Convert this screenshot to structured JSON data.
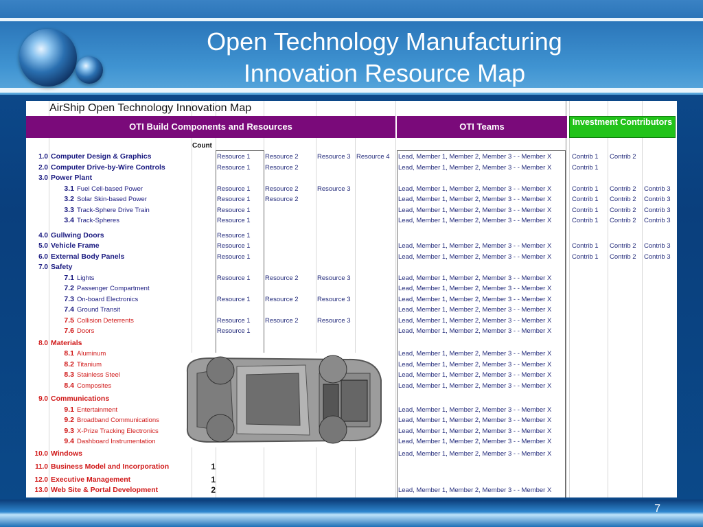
{
  "slide": {
    "title_line1": "Open Technology Manufacturing",
    "title_line2": "Innovation Resource Map",
    "page_number": "7"
  },
  "sheet": {
    "title": "AirShip Open Technology Innovation Map",
    "header_components": "OTI Build Components and Resources",
    "header_teams": "OTI Teams",
    "header_investment": "Investment Contributors",
    "header_count": "Count",
    "rows": [
      {
        "num": "1.0",
        "label": "Computer Design & Graphics",
        "level": 0,
        "red": false,
        "count": "",
        "res": [
          "Resource 1",
          "Resource 2",
          "Resource 3",
          "Resource 4"
        ],
        "team": "Lead, Member 1, Member 2, Member 3 - - Member X",
        "contrib": [
          "Contrib 1",
          "Contrib 2",
          ""
        ]
      },
      {
        "num": "2.0",
        "label": "Computer Drive-by-Wire Controls",
        "level": 0,
        "red": false,
        "count": "",
        "res": [
          "Resource 1",
          "Resource 2",
          "",
          ""
        ],
        "team": "Lead, Member 1, Member 2, Member 3 - - Member X",
        "contrib": [
          "Contrib 1",
          "",
          ""
        ]
      },
      {
        "num": "3.0",
        "label": "Power Plant",
        "level": 0,
        "red": false,
        "count": "",
        "res": [
          "",
          "",
          "",
          ""
        ],
        "team": "",
        "contrib": [
          "",
          "",
          ""
        ]
      },
      {
        "num": "3.1",
        "label": "Fuel Cell-based Power",
        "level": 1,
        "red": false,
        "count": "",
        "res": [
          "Resource 1",
          "Resource 2",
          "Resource 3",
          ""
        ],
        "team": "Lead, Member 1, Member 2, Member 3 - - Member X",
        "contrib": [
          "Contrib 1",
          "Contrib 2",
          "Contrib 3"
        ]
      },
      {
        "num": "3.2",
        "label": "Solar Skin-based Power",
        "level": 1,
        "red": false,
        "count": "",
        "res": [
          "Resource 1",
          "Resource 2",
          "",
          ""
        ],
        "team": "Lead, Member 1, Member 2, Member 3 - - Member X",
        "contrib": [
          "Contrib 1",
          "Contrib 2",
          "Contrib 3"
        ]
      },
      {
        "num": "3.3",
        "label": "Track-Sphere Drive Train",
        "level": 1,
        "red": false,
        "count": "",
        "res": [
          "Resource 1",
          "",
          "",
          ""
        ],
        "team": "Lead, Member 1, Member 2, Member 3 - - Member X",
        "contrib": [
          "Contrib 1",
          "Contrib 2",
          "Contrib 3"
        ]
      },
      {
        "num": "3.4",
        "label": "Track-Spheres",
        "level": 1,
        "red": false,
        "count": "",
        "res": [
          "Resource 1",
          "",
          "",
          ""
        ],
        "team": "Lead, Member 1, Member 2, Member 3 - - Member X",
        "contrib": [
          "Contrib 1",
          "Contrib 2",
          "Contrib 3"
        ]
      },
      {
        "num": "4.0",
        "label": "Gullwing Doors",
        "level": 0,
        "red": false,
        "count": "",
        "res": [
          "Resource 1",
          "",
          "",
          ""
        ],
        "team": "",
        "contrib": [
          "",
          "",
          ""
        ]
      },
      {
        "num": "5.0",
        "label": "Vehicle Frame",
        "level": 0,
        "red": false,
        "count": "",
        "res": [
          "Resource 1",
          "",
          "",
          ""
        ],
        "team": "Lead, Member 1, Member 2, Member 3 - - Member X",
        "contrib": [
          "Contrib 1",
          "Contrib 2",
          "Contrib 3"
        ]
      },
      {
        "num": "6.0",
        "label": "External Body Panels",
        "level": 0,
        "red": false,
        "count": "",
        "res": [
          "Resource 1",
          "",
          "",
          ""
        ],
        "team": "Lead, Member 1, Member 2, Member 3 - - Member X",
        "contrib": [
          "Contrib 1",
          "Contrib 2",
          "Contrib 3"
        ]
      },
      {
        "num": "7.0",
        "label": "Safety",
        "level": 0,
        "red": false,
        "count": "",
        "res": [
          "",
          "",
          "",
          ""
        ],
        "team": "",
        "contrib": [
          "",
          "",
          ""
        ]
      },
      {
        "num": "7.1",
        "label": "Lights",
        "level": 1,
        "red": false,
        "count": "",
        "res": [
          "Resource 1",
          "Resource 2",
          "Resource 3",
          ""
        ],
        "team": "Lead, Member 1, Member 2, Member 3 - - Member X",
        "contrib": [
          "",
          "",
          ""
        ]
      },
      {
        "num": "7.2",
        "label": "Passenger Compartment",
        "level": 1,
        "red": false,
        "count": "",
        "res": [
          "",
          "",
          "",
          ""
        ],
        "team": "Lead, Member 1, Member 2, Member 3 - - Member X",
        "contrib": [
          "",
          "",
          ""
        ]
      },
      {
        "num": "7.3",
        "label": "On-board Electronics",
        "level": 1,
        "red": false,
        "count": "",
        "res": [
          "Resource 1",
          "Resource 2",
          "Resource 3",
          ""
        ],
        "team": "Lead, Member 1, Member 2, Member 3 - - Member X",
        "contrib": [
          "",
          "",
          ""
        ]
      },
      {
        "num": "7.4",
        "label": "Ground Transit",
        "level": 1,
        "red": false,
        "count": "",
        "res": [
          "",
          "",
          "",
          ""
        ],
        "team": "Lead, Member 1, Member 2, Member 3 - - Member X",
        "contrib": [
          "",
          "",
          ""
        ]
      },
      {
        "num": "7.5",
        "label": "Collision Deterrents",
        "level": 1,
        "red": true,
        "count": "",
        "res": [
          "Resource 1",
          "Resource 2",
          "Resource 3",
          ""
        ],
        "team": "Lead, Member 1, Member 2, Member 3 - - Member X",
        "contrib": [
          "",
          "",
          ""
        ]
      },
      {
        "num": "7.6",
        "label": "Doors",
        "level": 1,
        "red": true,
        "count": "",
        "res": [
          "Resource 1",
          "",
          "",
          ""
        ],
        "team": "Lead, Member 1, Member 2, Member 3 - - Member X",
        "contrib": [
          "",
          "",
          ""
        ]
      },
      {
        "num": "8.0",
        "label": "Materials",
        "level": 0,
        "red": true,
        "count": "",
        "res": [
          "",
          "",
          "",
          ""
        ],
        "team": "",
        "contrib": [
          "",
          "",
          ""
        ]
      },
      {
        "num": "8.1",
        "label": "Aluminum",
        "level": 1,
        "red": true,
        "count": "",
        "res": [
          "",
          "",
          "",
          ""
        ],
        "team": "Lead, Member 1, Member 2, Member 3 - - Member X",
        "contrib": [
          "",
          "",
          ""
        ]
      },
      {
        "num": "8.2",
        "label": "Titanium",
        "level": 1,
        "red": true,
        "count": "",
        "res": [
          "",
          "",
          "",
          ""
        ],
        "team": "Lead, Member 1, Member 2, Member 3 - - Member X",
        "contrib": [
          "",
          "",
          ""
        ]
      },
      {
        "num": "8.3",
        "label": "Stainless Steel",
        "level": 1,
        "red": true,
        "count": "",
        "res": [
          "",
          "",
          "",
          ""
        ],
        "team": "Lead, Member 1, Member 2, Member 3 - - Member X",
        "contrib": [
          "",
          "",
          ""
        ]
      },
      {
        "num": "8.4",
        "label": "Composites",
        "level": 1,
        "red": true,
        "count": "",
        "res": [
          "",
          "",
          "",
          ""
        ],
        "team": "Lead, Member 1, Member 2, Member 3 - - Member X",
        "contrib": [
          "",
          "",
          ""
        ]
      },
      {
        "num": "9.0",
        "label": "Communications",
        "level": 0,
        "red": true,
        "count": "",
        "res": [
          "",
          "",
          "",
          ""
        ],
        "team": "",
        "contrib": [
          "",
          "",
          ""
        ]
      },
      {
        "num": "9.1",
        "label": "Entertainment",
        "level": 1,
        "red": true,
        "count": "",
        "res": [
          "",
          "",
          "",
          ""
        ],
        "team": "Lead, Member 1, Member 2, Member 3 - - Member X",
        "contrib": [
          "",
          "",
          ""
        ]
      },
      {
        "num": "9.2",
        "label": "Broadband Communications",
        "level": 1,
        "red": true,
        "count": "",
        "res": [
          "",
          "",
          "",
          ""
        ],
        "team": "Lead, Member 1, Member 2, Member 3 - - Member X",
        "contrib": [
          "",
          "",
          ""
        ]
      },
      {
        "num": "9.3",
        "label": "X-Prize Tracking Electronics",
        "level": 1,
        "red": true,
        "count": "",
        "res": [
          "",
          "",
          "",
          ""
        ],
        "team": "Lead, Member 1, Member 2, Member 3 - - Member X",
        "contrib": [
          "",
          "",
          ""
        ]
      },
      {
        "num": "9.4",
        "label": "Dashboard Instrumentation",
        "level": 1,
        "red": true,
        "count": "",
        "res": [
          "",
          "",
          "",
          ""
        ],
        "team": "Lead, Member 1, Member 2, Member 3 - - Member X",
        "contrib": [
          "",
          "",
          ""
        ]
      },
      {
        "num": "10.0",
        "label": "Windows",
        "level": 0,
        "red": true,
        "count": "",
        "res": [
          "",
          "",
          "",
          ""
        ],
        "team": "Lead, Member 1, Member 2, Member 3 - - Member X",
        "contrib": [
          "",
          "",
          ""
        ]
      },
      {
        "num": "11.0",
        "label": "Business Model and Incorporation",
        "level": 0,
        "red": true,
        "count": "1",
        "res": [
          "",
          "",
          "",
          ""
        ],
        "team": "",
        "contrib": [
          "",
          "",
          ""
        ]
      },
      {
        "num": "12.0",
        "label": "Executive Management",
        "level": 0,
        "red": true,
        "count": "1",
        "res": [
          "",
          "",
          "",
          ""
        ],
        "team": "",
        "contrib": [
          "",
          "",
          ""
        ]
      },
      {
        "num": "13.0",
        "label": "Web Site & Portal Development",
        "level": 0,
        "red": true,
        "count": "2",
        "res": [
          "",
          "",
          "",
          ""
        ],
        "team": "Lead, Member 1, Member 2, Member 3 - - Member X",
        "contrib": [
          "",
          "",
          ""
        ]
      }
    ]
  },
  "images": {
    "car_icon": "car-top-view-icon",
    "logo_icon": "globe-orbs-logo-icon"
  }
}
